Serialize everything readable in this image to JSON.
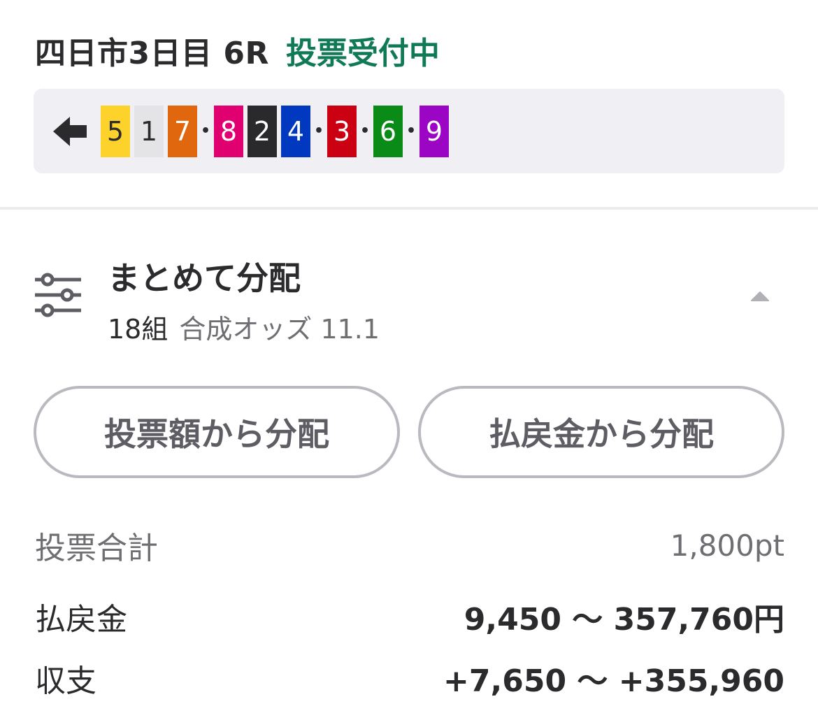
{
  "header": {
    "race_title": "四日市3日目 6R",
    "status": "投票受付中",
    "status_color": "#0f7a55"
  },
  "bet_line": {
    "back_icon": "arrow-left-icon",
    "groups": [
      [
        {
          "num": "5",
          "bg": "#fdd22b",
          "fg": "#2b2b2e"
        },
        {
          "num": "1",
          "bg": "#e4e4e7",
          "fg": "#2b2b2e"
        },
        {
          "num": "7",
          "bg": "#e0670d",
          "fg": "#ffffff"
        }
      ],
      [
        {
          "num": "8",
          "bg": "#e1006f",
          "fg": "#ffffff"
        },
        {
          "num": "2",
          "bg": "#2a2a2d",
          "fg": "#ffffff"
        },
        {
          "num": "4",
          "bg": "#0038c0",
          "fg": "#ffffff"
        }
      ],
      [
        {
          "num": "3",
          "bg": "#cc0013",
          "fg": "#ffffff"
        }
      ],
      [
        {
          "num": "6",
          "bg": "#0a8a17",
          "fg": "#ffffff"
        }
      ],
      [
        {
          "num": "9",
          "bg": "#9b06c4",
          "fg": "#ffffff"
        }
      ]
    ],
    "separator": "•"
  },
  "distribution": {
    "icon": "sliders-icon",
    "title": "まとめて分配",
    "count": "18組",
    "odds": "合成オッズ 11.1",
    "collapse_icon": "caret-up-icon"
  },
  "buttons": {
    "by_stake": "投票額から分配",
    "by_payout": "払戻金から分配"
  },
  "summary": {
    "total_label": "投票合計",
    "total_value": "1,800pt",
    "payout_label": "払戻金",
    "payout_value": "9,450 〜 357,760円",
    "profit_label": "収支",
    "profit_value": "+7,650 〜 +355,960"
  }
}
